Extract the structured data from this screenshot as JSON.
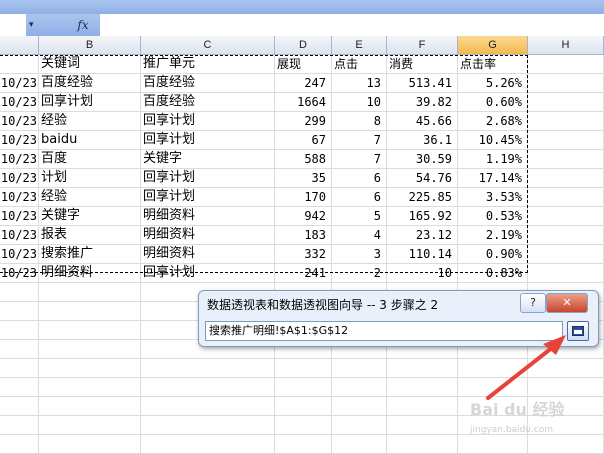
{
  "formula_bar": {
    "name_dropdown": "▾",
    "fx_label": "fx",
    "formula_value": ""
  },
  "columns": [
    {
      "label": "B",
      "selected": false
    },
    {
      "label": "C",
      "selected": false
    },
    {
      "label": "D",
      "selected": false
    },
    {
      "label": "E",
      "selected": false
    },
    {
      "label": "F",
      "selected": false
    },
    {
      "label": "G",
      "selected": true
    },
    {
      "label": "H",
      "selected": false
    }
  ],
  "header_row": [
    "",
    "关键词",
    "推广单元",
    "展现",
    "点击",
    "消费",
    "点击率"
  ],
  "rows": [
    [
      "10/23",
      "百度经验",
      "百度经验",
      "247",
      "13",
      "513.41",
      "5.26%"
    ],
    [
      "10/23",
      "回享计划",
      "百度经验",
      "1664",
      "10",
      "39.82",
      "0.60%"
    ],
    [
      "10/23",
      "经验",
      "回享计划",
      "299",
      "8",
      "45.66",
      "2.68%"
    ],
    [
      "10/23",
      "baidu",
      "回享计划",
      "67",
      "7",
      "36.1",
      "10.45%"
    ],
    [
      "10/23",
      "百度",
      "关键字",
      "588",
      "7",
      "30.59",
      "1.19%"
    ],
    [
      "10/23",
      "计划",
      "回享计划",
      "35",
      "6",
      "54.76",
      "17.14%"
    ],
    [
      "10/23",
      "经验",
      "回享计划",
      "170",
      "6",
      "225.85",
      "3.53%"
    ],
    [
      "10/23",
      "关键字",
      "明细资料",
      "942",
      "5",
      "165.92",
      "0.53%"
    ],
    [
      "10/23",
      "报表",
      "明细资料",
      "183",
      "4",
      "23.12",
      "2.19%"
    ],
    [
      "10/23",
      "搜索推广",
      "明细资料",
      "332",
      "3",
      "110.14",
      "0.90%"
    ],
    [
      "10/23",
      "明细资料",
      "回享计划",
      "241",
      "2",
      "10",
      "0.83%"
    ]
  ],
  "dialog": {
    "title": "数据透视表和数据透视图向导 -- 3 步骤之 2",
    "help_label": "?",
    "close_label": "✕",
    "range_value": "搜索推广明细!$A$1:$G$12"
  },
  "annotation_color": "#e8433a",
  "watermark": {
    "text": "Bai du 经验",
    "subtext": "jingyan.baidu.com"
  }
}
